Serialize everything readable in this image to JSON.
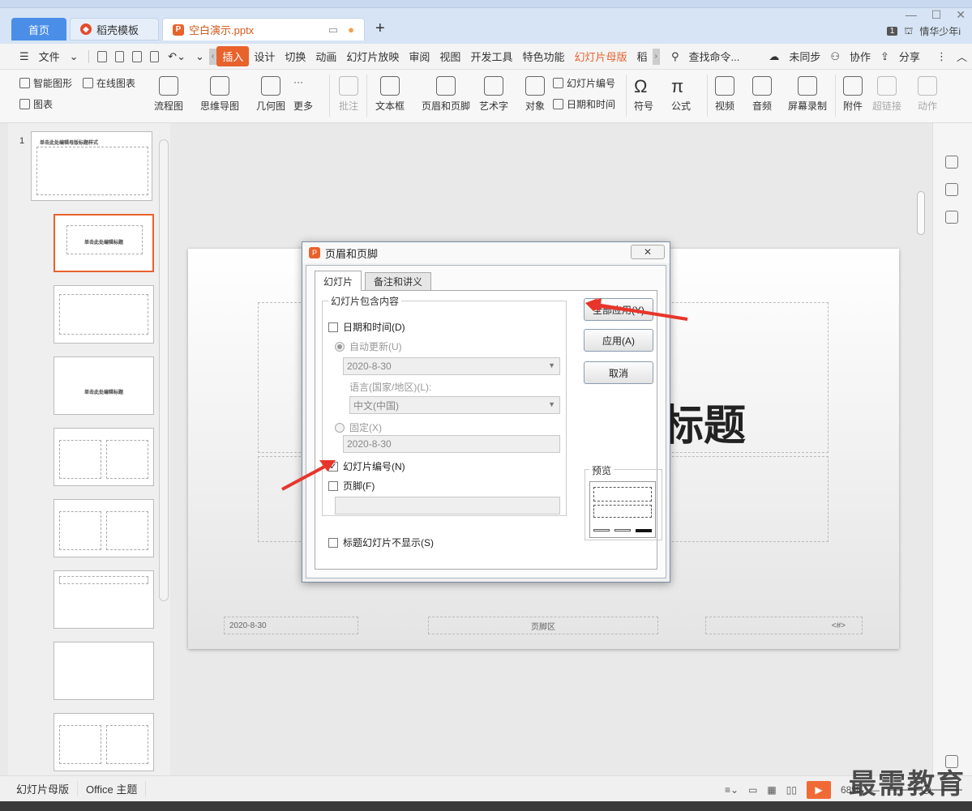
{
  "tabbar": {
    "home": "首页",
    "template": "稻壳模板",
    "doc": "空白演示.pptx",
    "add": "+",
    "page_badge": "1",
    "user": "情华少年i"
  },
  "menubar": {
    "file": "文件",
    "items": [
      "插入",
      "设计",
      "切换",
      "动画",
      "幻灯片放映",
      "审阅",
      "视图",
      "开发工具",
      "特色功能",
      "幻灯片母版",
      "稻"
    ],
    "search": "查找命令...",
    "sync": "未同步",
    "collab": "协作",
    "share": "分享"
  },
  "ribbon": {
    "smart_shape": "智能图形",
    "online_chart": "在线图表",
    "chart": "图表",
    "flowchart": "流程图",
    "mindmap": "思维导图",
    "geometry": "几何图",
    "more": "更多",
    "comment": "批注",
    "textbox": "文本框",
    "header_footer": "页眉和页脚",
    "wordart": "艺术字",
    "object": "对象",
    "slide_number": "幻灯片编号",
    "datetime": "日期和时间",
    "symbol": "符号",
    "formula": "公式",
    "video": "视频",
    "audio": "音频",
    "screen_record": "屏幕录制",
    "attachment": "附件",
    "hyperlink": "超链接",
    "action": "动作"
  },
  "leftpanel": {
    "slide_number": "1",
    "master_title": "单击此处编辑母版标题样式",
    "layout_title": "单击此处编辑标题",
    "layout_title2": "单击此处编辑标题"
  },
  "canvas": {
    "title": "标题",
    "date": "2020-8-30",
    "footer": "页脚区",
    "num": "<#>"
  },
  "dialog": {
    "title": "页眉和页脚",
    "close": "✕",
    "tab_slide": "幻灯片",
    "tab_notes": "备注和讲义",
    "group": "幻灯片包含内容",
    "datetime": "日期和时间(D)",
    "auto_update": "自动更新(U)",
    "auto_date": "2020-8-30",
    "language_label": "语言(国家/地区)(L):",
    "language": "中文(中国)",
    "fixed": "固定(X)",
    "fixed_date": "2020-8-30",
    "slide_number": "幻灯片编号(N)",
    "footer": "页脚(F)",
    "no_title": "标题幻灯片不显示(S)",
    "apply_all": "全部应用(Y)",
    "apply": "应用(A)",
    "cancel": "取消",
    "preview": "预览"
  },
  "statusbar": {
    "mode": "幻灯片母版",
    "theme": "Office 主题",
    "zoom": "68%"
  },
  "watermark": "最需教育",
  "colors": {
    "accent": "#e8622c",
    "tab_home": "#4a8ee8",
    "arrow": "#e8352b"
  }
}
